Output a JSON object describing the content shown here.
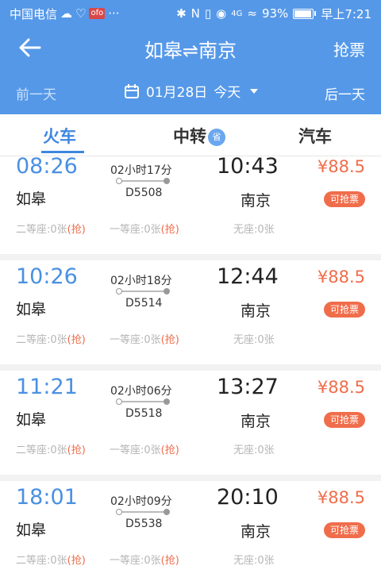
{
  "status_bar": {
    "carrier": "中国电信",
    "badge_text": "ofo",
    "more": "···",
    "signal_text": "4G",
    "battery_percent": 93,
    "battery_label": "93%",
    "time": "早上7:21"
  },
  "nav": {
    "title": "如皋⇌南京",
    "right_action": "抢票"
  },
  "date_bar": {
    "prev_day": "前一天",
    "date": "01月28日",
    "date_suffix": "今天",
    "next_day": "后一天"
  },
  "tabs": [
    {
      "label": "火车",
      "active": true
    },
    {
      "label": "中转",
      "badge": "省",
      "active": false
    },
    {
      "label": "汽车",
      "active": false
    }
  ],
  "trains": [
    {
      "dep_time": "08:26",
      "dep_station": "如皋",
      "duration": "02小时17分",
      "code": "D5508",
      "arr_time": "10:43",
      "arr_station": "南京",
      "price": "¥88.5",
      "action": "可抢票",
      "seat_2": "二等座:0张",
      "seat_1": "一等座:0张",
      "grab": "(抢)",
      "no_seat": "无座:0张"
    },
    {
      "dep_time": "10:26",
      "dep_station": "如皋",
      "duration": "02小时18分",
      "code": "D5514",
      "arr_time": "12:44",
      "arr_station": "南京",
      "price": "¥88.5",
      "action": "可抢票",
      "seat_2": "二等座:0张",
      "seat_1": "一等座:0张",
      "grab": "(抢)",
      "no_seat": "无座:0张"
    },
    {
      "dep_time": "11:21",
      "dep_station": "如皋",
      "duration": "02小时06分",
      "code": "D5518",
      "arr_time": "13:27",
      "arr_station": "南京",
      "price": "¥88.5",
      "action": "可抢票",
      "seat_2": "二等座:0张",
      "seat_1": "一等座:0张",
      "grab": "(抢)",
      "no_seat": "无座:0张"
    },
    {
      "dep_time": "18:01",
      "dep_station": "如皋",
      "duration": "02小时09分",
      "code": "D5538",
      "arr_time": "20:10",
      "arr_station": "南京",
      "price": "¥88.5",
      "action": "可抢票",
      "seat_2": "二等座:0张",
      "seat_1": "一等座:0张",
      "grab": "(抢)",
      "no_seat": "无座:0张"
    }
  ],
  "colors": {
    "header_bg": "#5598e8",
    "accent_blue": "#3e86e0",
    "price_orange": "#f06d4b",
    "seat_gray": "#b5b5b5"
  },
  "icons": [
    "back-arrow-icon",
    "calendar-icon",
    "dropdown-caret-icon",
    "battery-icon",
    "wifi-icon",
    "bluetooth-icon"
  ]
}
